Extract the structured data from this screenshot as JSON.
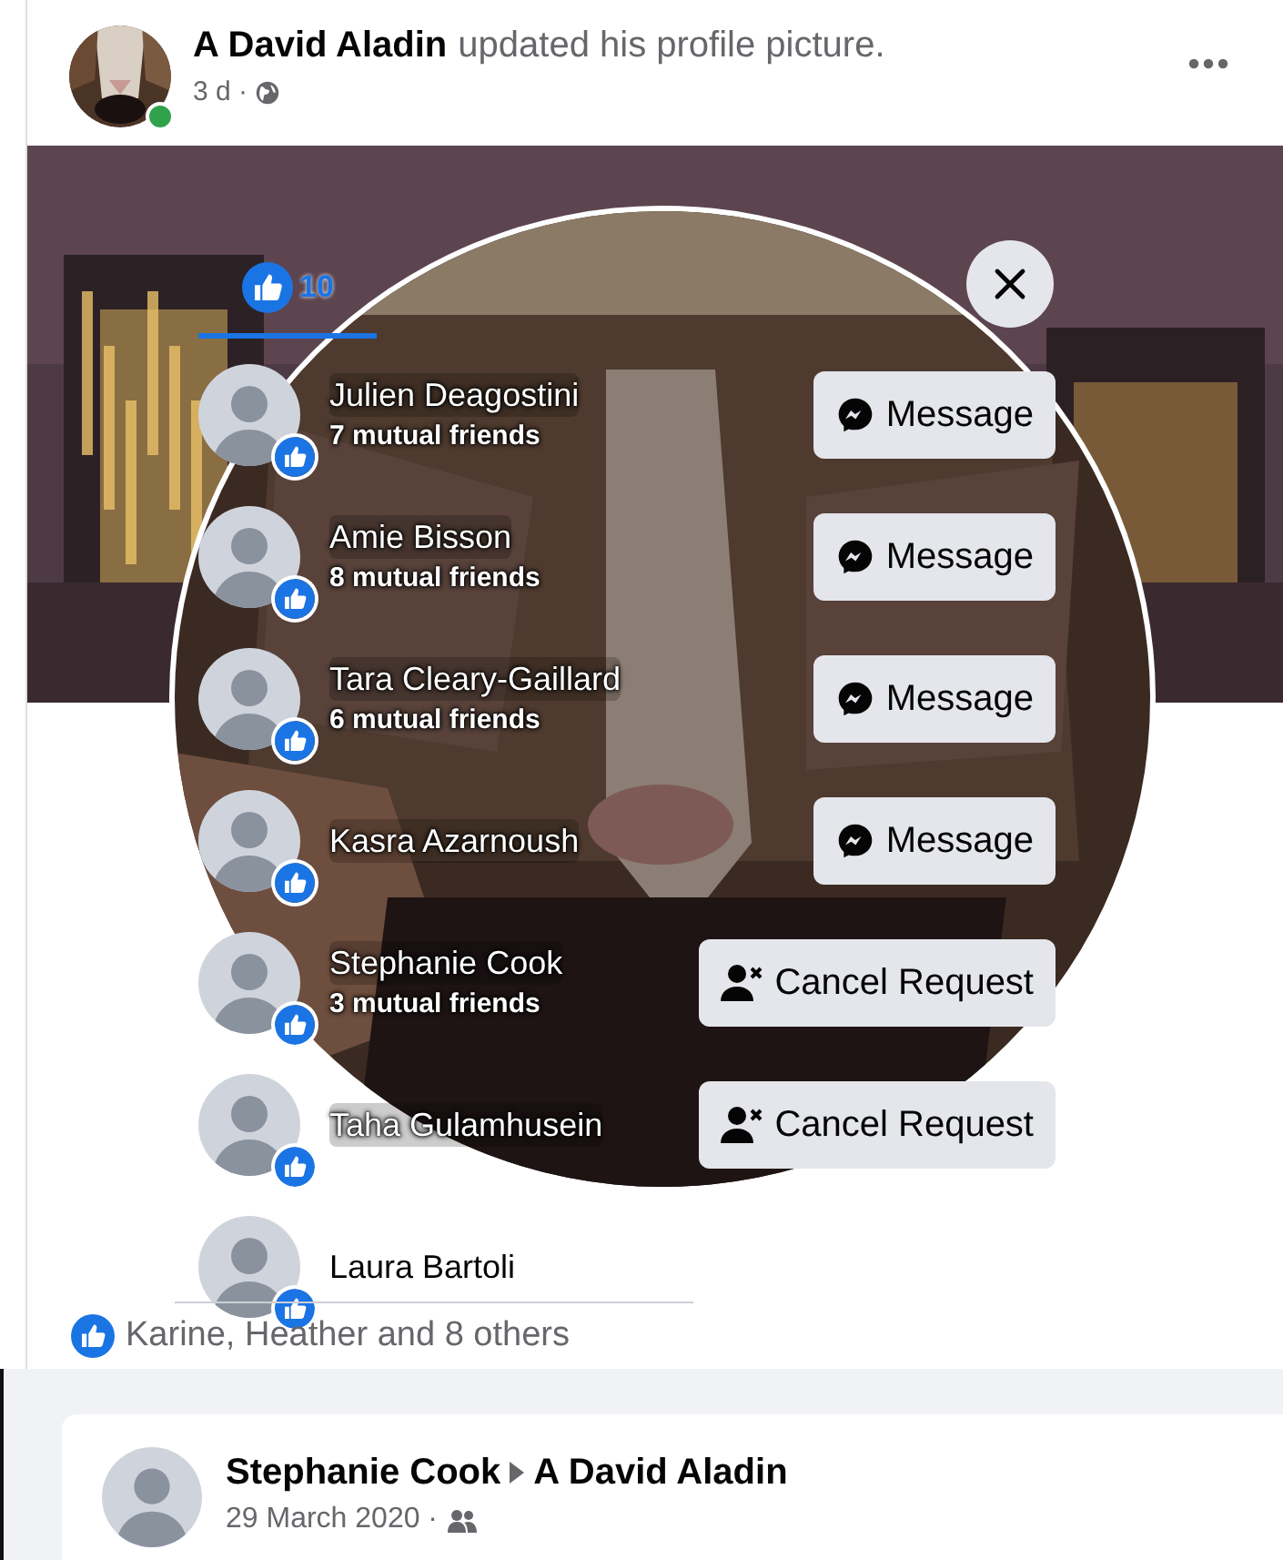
{
  "post": {
    "author": "A David Aladin",
    "action": "updated his profile picture.",
    "time": "3 d ·",
    "online": true
  },
  "reactions_dialog": {
    "tabs": [
      {
        "count": "10",
        "selected": true
      }
    ],
    "people": [
      {
        "name": "Julien Deagostini",
        "mutual": "7 mutual friends",
        "button": {
          "kind": "message",
          "label": "Message"
        }
      },
      {
        "name": "Amie Bisson",
        "mutual": "8 mutual friends",
        "button": {
          "kind": "message",
          "label": "Message"
        }
      },
      {
        "name": "Tara Cleary-Gaillard",
        "mutual": "6 mutual friends",
        "button": {
          "kind": "message",
          "label": "Message"
        }
      },
      {
        "name": "Kasra Azarnoush",
        "button": {
          "kind": "message",
          "label": "Message"
        }
      },
      {
        "name": "Stephanie Cook",
        "mutual": "3 mutual friends",
        "button": {
          "kind": "cancel_request",
          "label": "Cancel Request"
        }
      },
      {
        "name": "Taha Gulamhusein",
        "button": {
          "kind": "cancel_request",
          "label": "Cancel Request"
        }
      },
      {
        "name": "Laura Bartoli"
      }
    ]
  },
  "likes_summary": "Karine, Heather and 8 others",
  "next_post": {
    "author": "Stephanie Cook",
    "target": "A David Aladin",
    "date": "29 March 2020 ·"
  }
}
